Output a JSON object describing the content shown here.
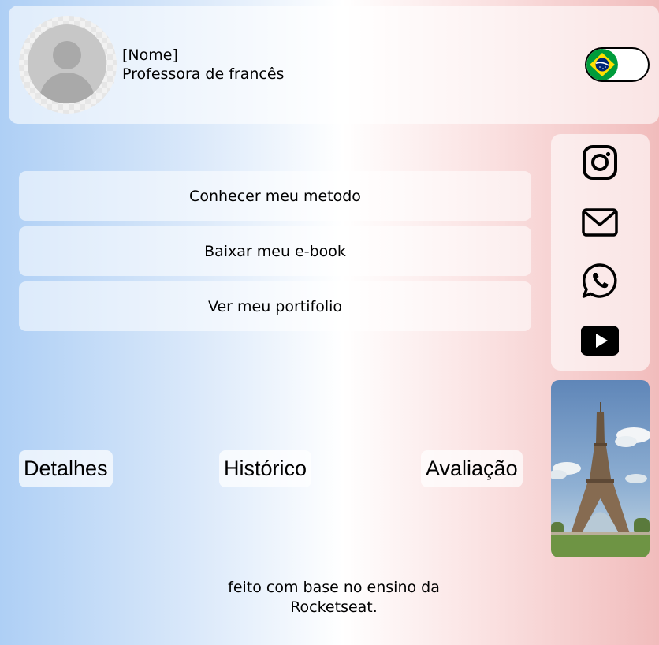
{
  "profile": {
    "name": "[Nome]",
    "title": "Professora de francês",
    "avatar_icon": "user-placeholder-icon"
  },
  "language_toggle": {
    "flag_icon": "brazil-flag-icon"
  },
  "links": [
    {
      "label": "Conhecer meu metodo"
    },
    {
      "label": "Baixar meu e-book"
    },
    {
      "label": "Ver meu portifolio"
    }
  ],
  "social": [
    {
      "icon": "instagram-icon"
    },
    {
      "icon": "mail-icon"
    },
    {
      "icon": "whatsapp-icon"
    },
    {
      "icon": "youtube-icon"
    }
  ],
  "photo": {
    "subject": "eiffel-tower-photo"
  },
  "tabs": [
    {
      "label": "Detalhes"
    },
    {
      "label": "Histórico"
    },
    {
      "label": "Avaliação"
    }
  ],
  "footer": {
    "text": "feito com base no ensino da",
    "link_label": "Rocketseat",
    "suffix": "."
  },
  "colors": {
    "gradient_left": "#aecff5",
    "gradient_center": "#ffffff",
    "gradient_right": "#f1bcbc"
  }
}
